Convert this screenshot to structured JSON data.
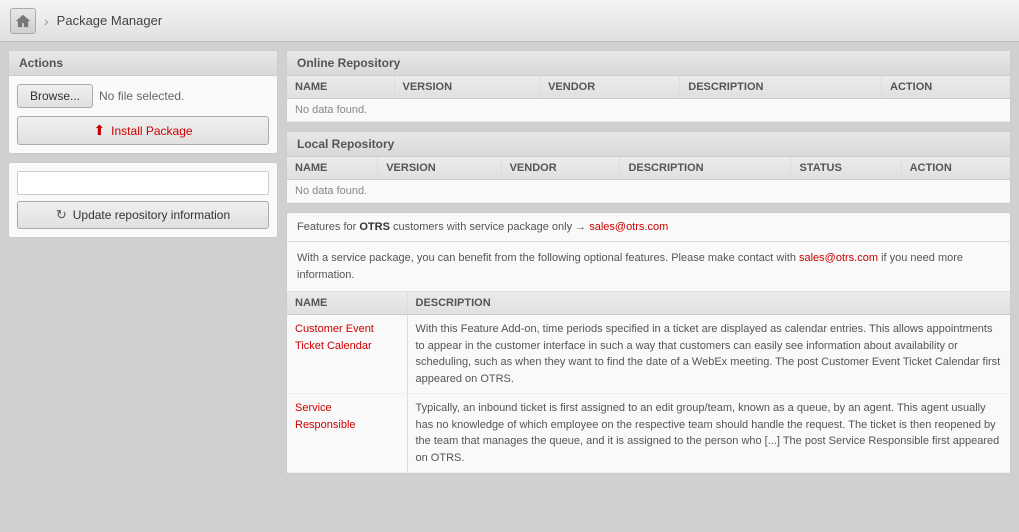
{
  "header": {
    "home_title": "Home",
    "page_title": "Package Manager",
    "chevron": "›"
  },
  "sidebar": {
    "actions_title": "Actions",
    "browse_label": "Browse...",
    "no_file_text": "No file selected.",
    "install_label": "Install Package",
    "repo_input_value": "",
    "update_repo_label": "Update repository information"
  },
  "online_repo": {
    "title": "Online Repository",
    "columns": [
      "NAME",
      "VERSION",
      "VENDOR",
      "DESCRIPTION",
      "ACTION"
    ],
    "no_data": "No data found."
  },
  "local_repo": {
    "title": "Local Repository",
    "columns": [
      "NAME",
      "VERSION",
      "VENDOR",
      "DESCRIPTION",
      "STATUS",
      "ACTION"
    ],
    "no_data": "No data found."
  },
  "features": {
    "header_prefix": "Features for ",
    "brand": "OTRS",
    "header_middle": " customers with service package only → ",
    "email": "sales@otrs.com",
    "description_text": "With a service package, you can benefit from the following optional features. Please make contact with ",
    "description_email": "sales@otrs.com",
    "description_suffix": " if you need more information.",
    "columns": [
      "NAME",
      "DESCRIPTION"
    ],
    "items": [
      {
        "name": "Customer Event Ticket Calendar",
        "name_line1": "Customer Event",
        "name_line2": "Ticket Calendar",
        "description": "With this Feature Add-on, time periods specified in a ticket are displayed as calendar entries. This allows appointments to appear in the customer interface in such a way that customers can easily see information about availability or scheduling, such as when they want to find the date of a WebEx meeting. The post Customer Event Ticket Calendar first appeared on OTRS."
      },
      {
        "name": "Service Responsible",
        "name_line1": "Service",
        "name_line2": "Responsible",
        "description": "Typically, an inbound ticket is first assigned to an edit group/team, known as a queue, by an agent. This agent usually has no knowledge of which employee on the respective team should handle the request. The ticket is then reopened by the team that manages the queue, and it is assigned to the person who [...] The post Service Responsible first appeared on OTRS."
      }
    ]
  }
}
